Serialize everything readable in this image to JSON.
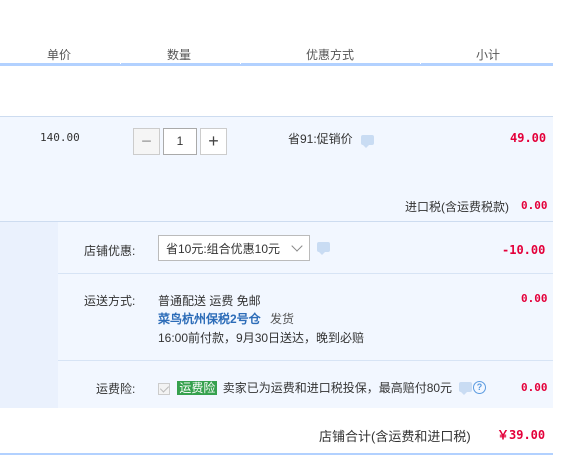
{
  "header": {
    "unit_price": "单价",
    "quantity": "数量",
    "discount": "优惠方式",
    "subtotal": "小计"
  },
  "item": {
    "unit_price": "140.00",
    "quantity": "1",
    "minus_label": "−",
    "plus_label": "+",
    "discount_text": "省91:促销价",
    "subtotal": "49.00",
    "import_tax_label": "进口税(含运费税款)",
    "import_tax_value": "0.00"
  },
  "shop": {
    "discount_label": "店铺优惠:",
    "discount_selected": "省10元:组合优惠10元",
    "discount_value": "-10.00",
    "shipping_label": "运送方式:",
    "shipping_method": "普通配送 运费 免邮",
    "warehouse": "菜鸟杭州保税2号仓",
    "ship_word": "发货",
    "delivery_note": "16:00前付款，9月30日送达，晚到必赔",
    "shipping_value": "0.00",
    "insurance_label": "运费险:",
    "insurance_tag": "运费险",
    "insurance_text": "卖家已为运费和进口税投保，最高赔付80元",
    "insurance_value": "0.00",
    "help_glyph": "?",
    "total_label": "店铺合计(含运费和进口税)",
    "total_value": "￥39.00"
  },
  "colors": {
    "price_red": "#e4003a",
    "accent_blue": "#b2d1ff",
    "tag_green": "#36a14e"
  },
  "icons": [
    "chat-icon",
    "chevron-down-icon",
    "checkbox-icon",
    "help-icon"
  ]
}
